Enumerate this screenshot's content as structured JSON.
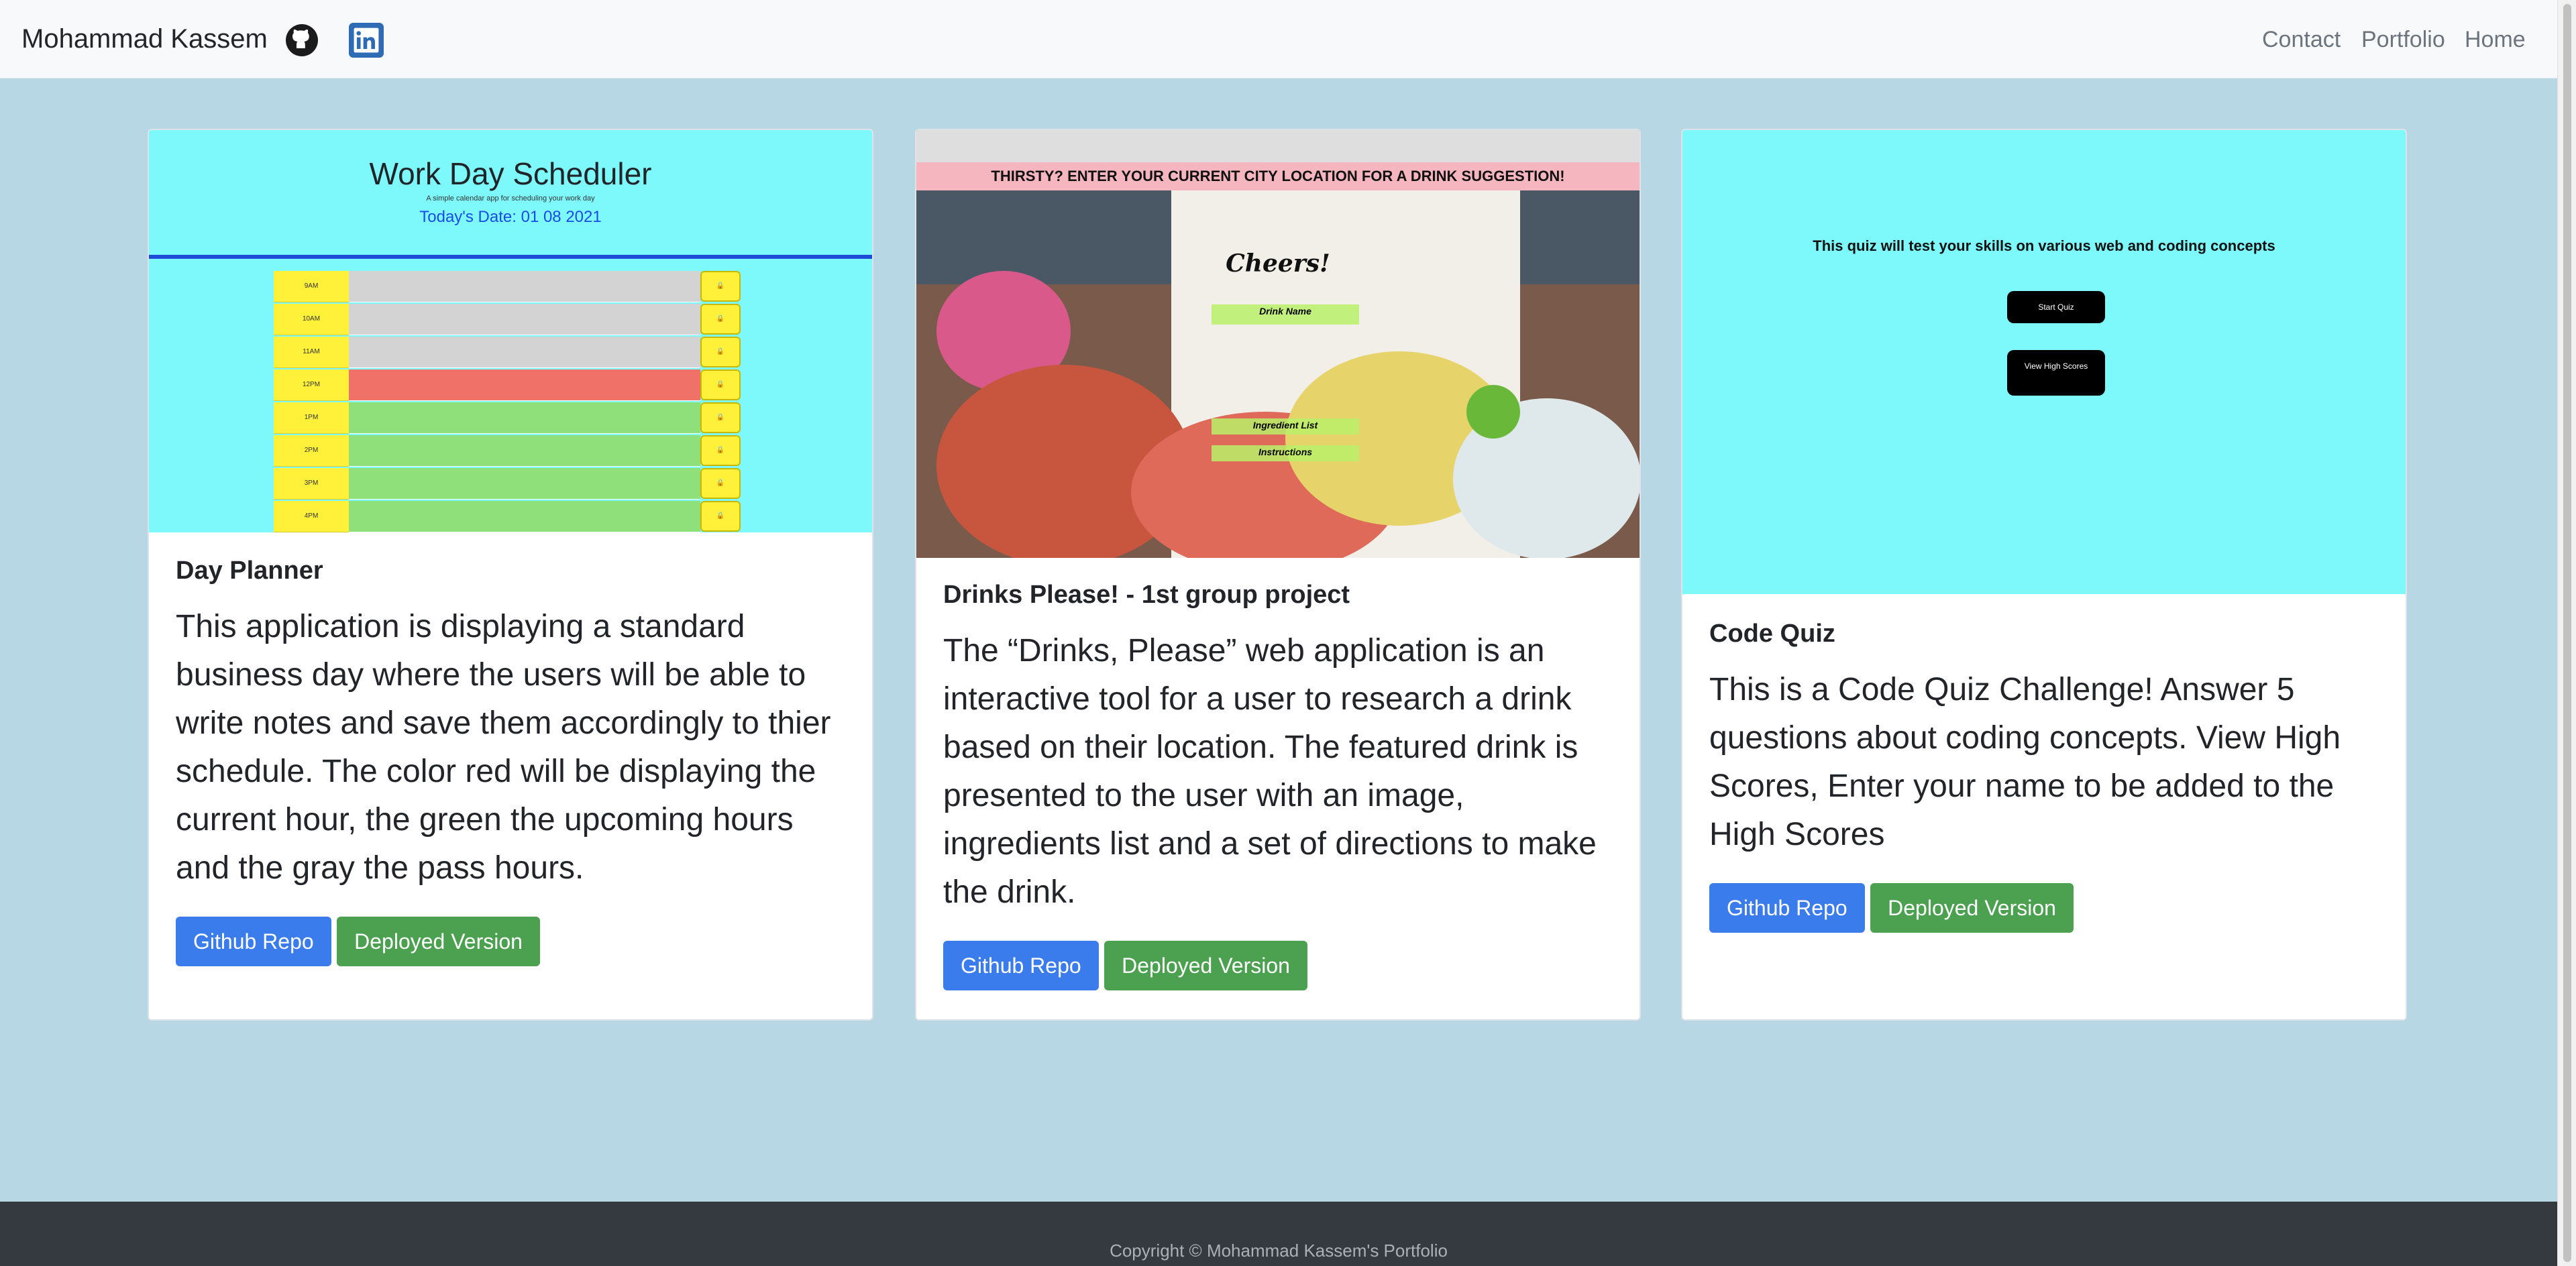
{
  "navbar": {
    "brand": "Mohammad Kassem",
    "links": [
      "Contact",
      "Portfolio",
      "Home"
    ],
    "icons": [
      "github-icon",
      "linkedin-icon"
    ]
  },
  "cards": [
    {
      "title": "Day Planner",
      "text": "This application is displaying a standard business day where the users will be able to write notes and save them accordingly to thier schedule. The color red will be displaying the current hour, the green the upcoming hours and the gray the pass hours.",
      "buttons": [
        "Github Repo",
        "Deployed Version"
      ],
      "preview": {
        "title": "Work Day Scheduler",
        "subtitle": "A simple calendar app for scheduling your work day",
        "date": "Today's Date: 01 08 2021",
        "hours": [
          "9AM",
          "10AM",
          "11AM",
          "12PM",
          "1PM",
          "2PM",
          "3PM",
          "4PM"
        ],
        "row_colors": [
          "#d3d3d3",
          "#d3d3d3",
          "#d3d3d3",
          "#f07167",
          "#8fe07a",
          "#8fe07a",
          "#8fe07a",
          "#8fe07a"
        ]
      }
    },
    {
      "title": "Drinks Please! - 1st group project",
      "text": "The “Drinks, Please” web application is an interactive tool for a user to research a drink based on their location. The featured drink is presented to the user with an image, ingredients list and a set of directions to make the drink.",
      "buttons": [
        "Github Repo",
        "Deployed Version"
      ],
      "preview": {
        "banner": "THIRSTY? ENTER YOUR CURRENT CITY LOCATION FOR A DRINK SUGGESTION!",
        "cheers": "Cheers!",
        "labels": [
          "Drink Name",
          "Ingredient List",
          "Instructions"
        ]
      }
    },
    {
      "title": "Code Quiz",
      "text": "This is a Code Quiz Challenge! Answer 5 questions about coding concepts. View High Scores, Enter your name to be added to the High Scores",
      "buttons": [
        "Github Repo",
        "Deployed Version"
      ],
      "preview": {
        "text": "This quiz will test your skills on various web and coding concepts",
        "start": "Start Quiz",
        "scores": "View High Scores"
      }
    }
  ],
  "footer": {
    "copyright": "Copyright © Mohammad Kassem's Portfolio"
  },
  "colors": {
    "background": "#b6d7e3",
    "primary": "#3b7ced",
    "success": "#4ba14f",
    "footer": "#343a40"
  }
}
